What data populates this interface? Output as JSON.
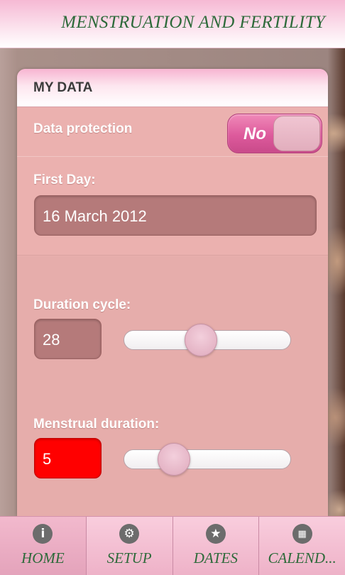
{
  "header": {
    "title": "MENSTRUATION AND FERTILITY"
  },
  "panel": {
    "title": "MY DATA",
    "data_protection": {
      "label": "Data protection",
      "value": "No"
    },
    "first_day": {
      "label": "First Day:",
      "value": "16 March 2012"
    },
    "duration_cycle": {
      "label": "Duration cycle:",
      "value": "28",
      "slider_fraction": 0.45
    },
    "menstrual_duration": {
      "label": "Menstrual duration:",
      "value": "5",
      "slider_fraction": 0.25
    }
  },
  "tabs": [
    {
      "label": "HOME",
      "icon": "info-icon",
      "active": true
    },
    {
      "label": "SETUP",
      "icon": "gear-icon",
      "active": false
    },
    {
      "label": "DATES",
      "icon": "star-icon",
      "active": false
    },
    {
      "label": "CALEND...",
      "icon": "grid-icon",
      "active": false
    }
  ],
  "colors": {
    "header_text": "#2d6a3a",
    "panel_bg": "#e9b0ae",
    "toggle": "#dd5a9c",
    "error_field": "#ff0000"
  }
}
